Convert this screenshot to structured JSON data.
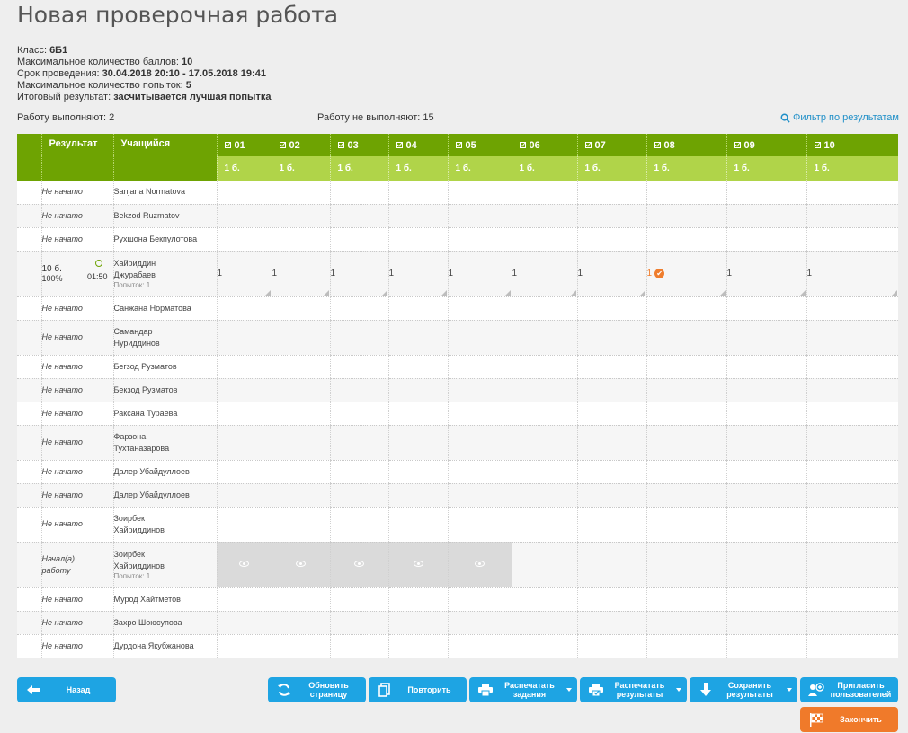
{
  "title": "Новая проверочная работа",
  "info": {
    "class_label": "Класс:",
    "class_value": "6Б1",
    "max_score_label": "Максимальное количество баллов:",
    "max_score_value": "10",
    "period_label": "Срок проведения:",
    "period_value": "30.04.2018 20:10 - 17.05.2018 19:41",
    "max_attempts_label": "Максимальное количество попыток:",
    "max_attempts_value": "5",
    "result_label": "Итоговый результат:",
    "result_value": "засчитывается лучшая попытка"
  },
  "counts": {
    "doing": "Работу выполняют: 2",
    "not_doing": "Работу не выполняют: 15"
  },
  "filter_label": "Фильтр по результатам",
  "table": {
    "col_result": "Результат",
    "col_student": "Учащийся",
    "tasks": [
      {
        "num": "01",
        "points": "1 б."
      },
      {
        "num": "02",
        "points": "1 б."
      },
      {
        "num": "03",
        "points": "1 б."
      },
      {
        "num": "04",
        "points": "1 б."
      },
      {
        "num": "05",
        "points": "1 б."
      },
      {
        "num": "06",
        "points": "1 б."
      },
      {
        "num": "07",
        "points": "1 б."
      },
      {
        "num": "08",
        "points": "1 б."
      },
      {
        "num": "09",
        "points": "1 б."
      },
      {
        "num": "10",
        "points": "1 б."
      }
    ],
    "rows": [
      {
        "status": "Не начато",
        "name_lines": [
          "Sanjana Normatova"
        ]
      },
      {
        "status": "Не начато",
        "name_lines": [
          "Bekzod Ruzmatov"
        ]
      },
      {
        "status": "Не начато",
        "name_lines": [
          "Рухшона Бекпулотова"
        ]
      },
      {
        "score": "10 б.",
        "percent": "100%",
        "time": "01:50",
        "name_lines": [
          "Хайриддин",
          "Джурабаев"
        ],
        "attempts": "Попыток: 1",
        "answers": [
          "1",
          "1",
          "1",
          "1",
          "1",
          "1",
          "1",
          "1",
          "1",
          "1"
        ]
      },
      {
        "status": "Не начато",
        "name_lines": [
          "Санжана Норматова"
        ]
      },
      {
        "status": "Не начато",
        "name_lines": [
          "Самандар",
          "Нуриддинов"
        ]
      },
      {
        "status": "Не начато",
        "name_lines": [
          "Бегзод Рузматов"
        ]
      },
      {
        "status": "Не начато",
        "name_lines": [
          "Бекзод Рузматов"
        ]
      },
      {
        "status": "Не начато",
        "name_lines": [
          "Раксана Тураева"
        ]
      },
      {
        "status": "Не начато",
        "name_lines": [
          "Фарзона",
          "Тухтаназарова"
        ]
      },
      {
        "status": "Не начато",
        "name_lines": [
          "Далер Убайдуллоев"
        ]
      },
      {
        "status": "Не начато",
        "name_lines": [
          "Далер Убайдуллоев"
        ]
      },
      {
        "status": "Не начато",
        "name_lines": [
          "Зоирбек",
          "Хайриддинов"
        ]
      },
      {
        "status_lines": [
          "Начал(а)",
          "работу"
        ],
        "name_lines": [
          "Зоирбек",
          "Хайриддинов"
        ],
        "attempts": "Попыток: 1"
      },
      {
        "status": "Не начато",
        "name_lines": [
          "Мурод Хайтметов"
        ]
      },
      {
        "status": "Не начато",
        "name_lines": [
          "Захро Шоюсупова"
        ]
      },
      {
        "status": "Не начато",
        "name_lines": [
          "Дурдона Якубжанова"
        ]
      }
    ]
  },
  "buttons": {
    "back": "Назад",
    "refresh": [
      "Обновить",
      "страницу"
    ],
    "repeat": "Повторить",
    "print_tasks": [
      "Распечатать",
      "задания"
    ],
    "print_results": [
      "Распечатать",
      "результаты"
    ],
    "save_results": [
      "Сохранить",
      "результаты"
    ],
    "invite": [
      "Пригласить",
      "пользователей"
    ],
    "finish": "Закончить"
  },
  "colors": {
    "header_dark": "#6ea302",
    "header_light": "#b0d449",
    "button_blue": "#1ea4e3",
    "button_orange": "#f07a2a",
    "correct_orange": "#ef7d2d"
  }
}
